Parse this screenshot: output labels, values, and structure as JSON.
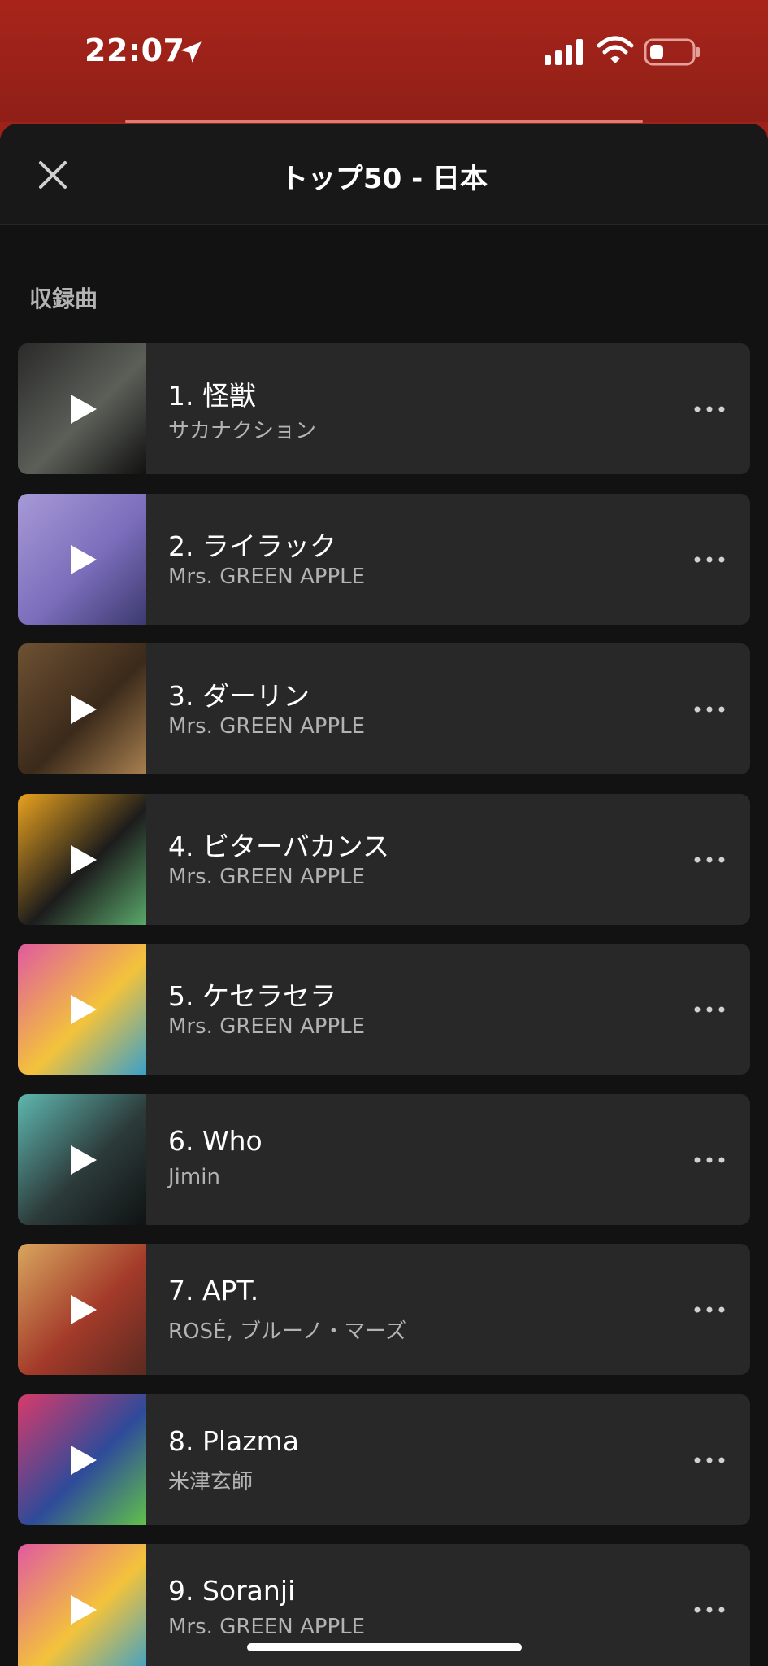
{
  "status": {
    "time": "22:07"
  },
  "header": {
    "title": "トップ50 - 日本"
  },
  "section": {
    "label": "収録曲"
  },
  "tracks": [
    {
      "title": "1. 怪獣",
      "artist": "サカナクション",
      "art_colors": [
        "#2a2a2a",
        "#5c5f58",
        "#111111"
      ]
    },
    {
      "title": "2. ライラック",
      "artist": "Mrs. GREEN APPLE",
      "art_colors": [
        "#a79ad6",
        "#7b6dbb",
        "#3b3a6e"
      ]
    },
    {
      "title": "3. ダーリン",
      "artist": "Mrs. GREEN APPLE",
      "art_colors": [
        "#6e5132",
        "#3b2a1a",
        "#a88050"
      ]
    },
    {
      "title": "4. ビターバカンス",
      "artist": "Mrs. GREEN APPLE",
      "art_colors": [
        "#e9a21e",
        "#1c1c1c",
        "#5aa86a"
      ]
    },
    {
      "title": "5. ケセラセラ",
      "artist": "Mrs. GREEN APPLE",
      "art_colors": [
        "#e05aa0",
        "#f3c33b",
        "#3aa0c8"
      ]
    },
    {
      "title": "6. Who",
      "artist": "Jimin",
      "art_colors": [
        "#5fb7b0",
        "#2c3b3a",
        "#0f1212"
      ]
    },
    {
      "title": "7. APT.",
      "artist": "ROSÉ, ブルーノ・マーズ",
      "art_colors": [
        "#d8a65e",
        "#a33a2a",
        "#5a2a20"
      ]
    },
    {
      "title": "8. Plazma",
      "artist": "米津玄師",
      "art_colors": [
        "#d83a6a",
        "#2e4b9a",
        "#62c04a"
      ]
    },
    {
      "title": "9. Soranji",
      "artist": "Mrs. GREEN APPLE",
      "art_colors": [
        "#e05aa0",
        "#f3c33b",
        "#3aa0c8"
      ]
    }
  ]
}
